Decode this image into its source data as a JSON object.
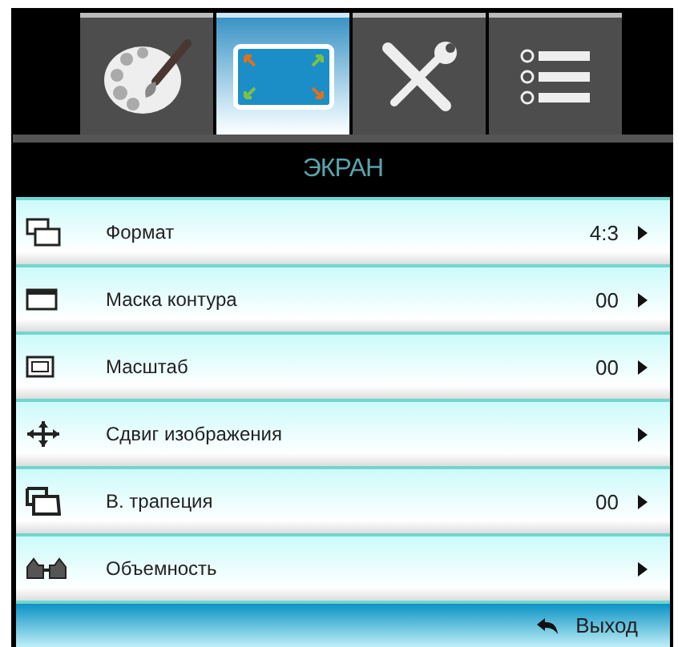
{
  "tabs": [
    {
      "kind": "palette",
      "selected": false
    },
    {
      "kind": "display",
      "selected": true
    },
    {
      "kind": "tools",
      "selected": false
    },
    {
      "kind": "list",
      "selected": false
    }
  ],
  "title": "ЭКРАН",
  "rows": [
    {
      "kind": "format",
      "label": "Формат",
      "value": "4:3"
    },
    {
      "kind": "mask",
      "label": "Маска контура",
      "value": "00"
    },
    {
      "kind": "zoom",
      "label": "Масштаб",
      "value": "00"
    },
    {
      "kind": "shift",
      "label": "Сдвиг изображения"
    },
    {
      "kind": "keystone",
      "label": "В. трапеция",
      "value": "00"
    },
    {
      "kind": "glasses",
      "label": "Объемность"
    }
  ],
  "footer": {
    "label": "Выход"
  }
}
